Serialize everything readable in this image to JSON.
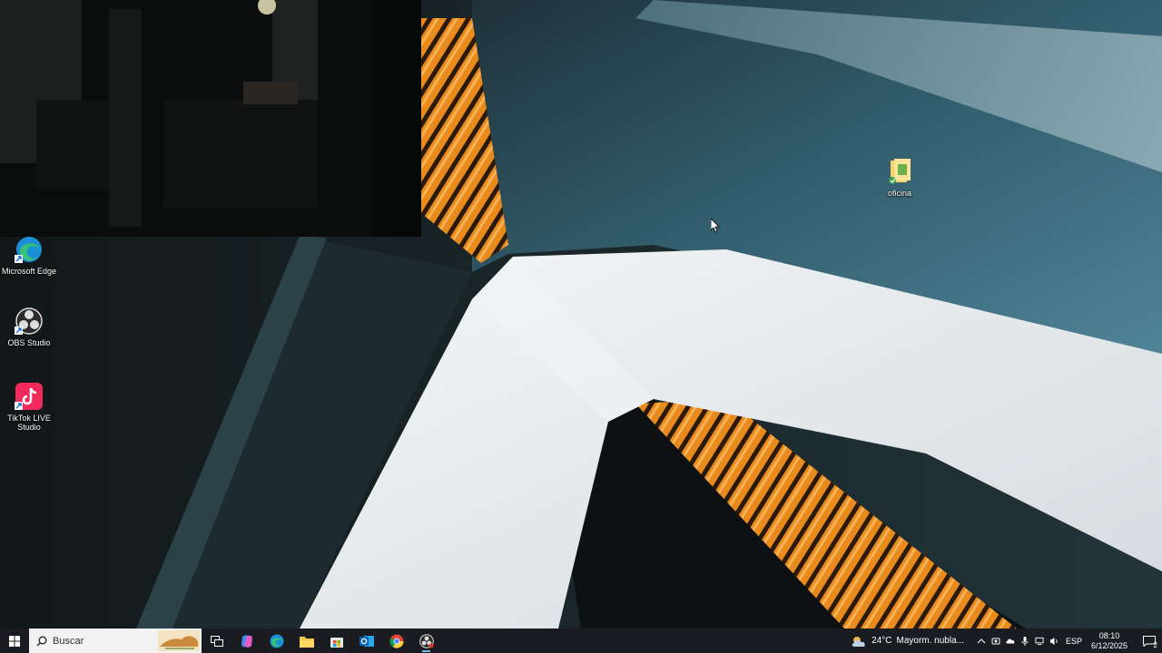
{
  "desktop": {
    "icons": [
      {
        "label": "Microsoft Edge"
      },
      {
        "label": "OBS Studio"
      },
      {
        "label": "TikTok LIVE Studio"
      },
      {
        "label": "oficina"
      }
    ]
  },
  "taskbar": {
    "search_placeholder": "Buscar",
    "apps": [
      "task-view",
      "copilot",
      "edge",
      "file-explorer",
      "microsoft-store",
      "outlook",
      "chrome",
      "obs-studio"
    ],
    "weather": {
      "temp": "24°C",
      "text": "Mayorm. nubla..."
    },
    "language": "ESP",
    "time": "08:10",
    "date": "6/12/2025",
    "notifications": "2"
  },
  "colors": {
    "taskbar": "#1a1c22",
    "wall_teal": "#3f6f80",
    "pipe_orange": "#e98a1c",
    "concrete_white": "#e9edf0"
  }
}
